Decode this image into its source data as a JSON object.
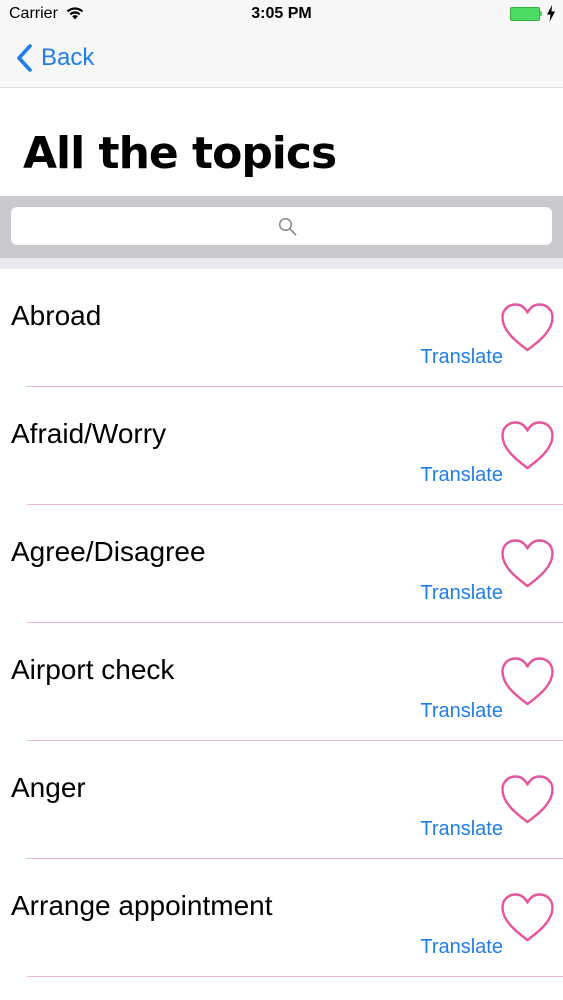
{
  "status_bar": {
    "carrier": "Carrier",
    "time": "3:05 PM",
    "battery_color": "#4cd964"
  },
  "nav": {
    "back_label": "Back",
    "back_icon": "chevron-left-icon",
    "accent_color": "#1f7ee8"
  },
  "page": {
    "title": "All the topics"
  },
  "search": {
    "value": "",
    "placeholder": "",
    "icon": "search-icon"
  },
  "topics": {
    "heart_color": "#e5559a",
    "items": [
      {
        "title": "Abroad",
        "action": "Translate",
        "favorite": false
      },
      {
        "title": "Afraid/Worry",
        "action": "Translate",
        "favorite": false
      },
      {
        "title": "Agree/Disagree",
        "action": "Translate",
        "favorite": false
      },
      {
        "title": "Airport check",
        "action": "Translate",
        "favorite": false
      },
      {
        "title": "Anger",
        "action": "Translate",
        "favorite": false
      },
      {
        "title": "Arrange appointment",
        "action": "Translate",
        "favorite": false
      }
    ]
  }
}
